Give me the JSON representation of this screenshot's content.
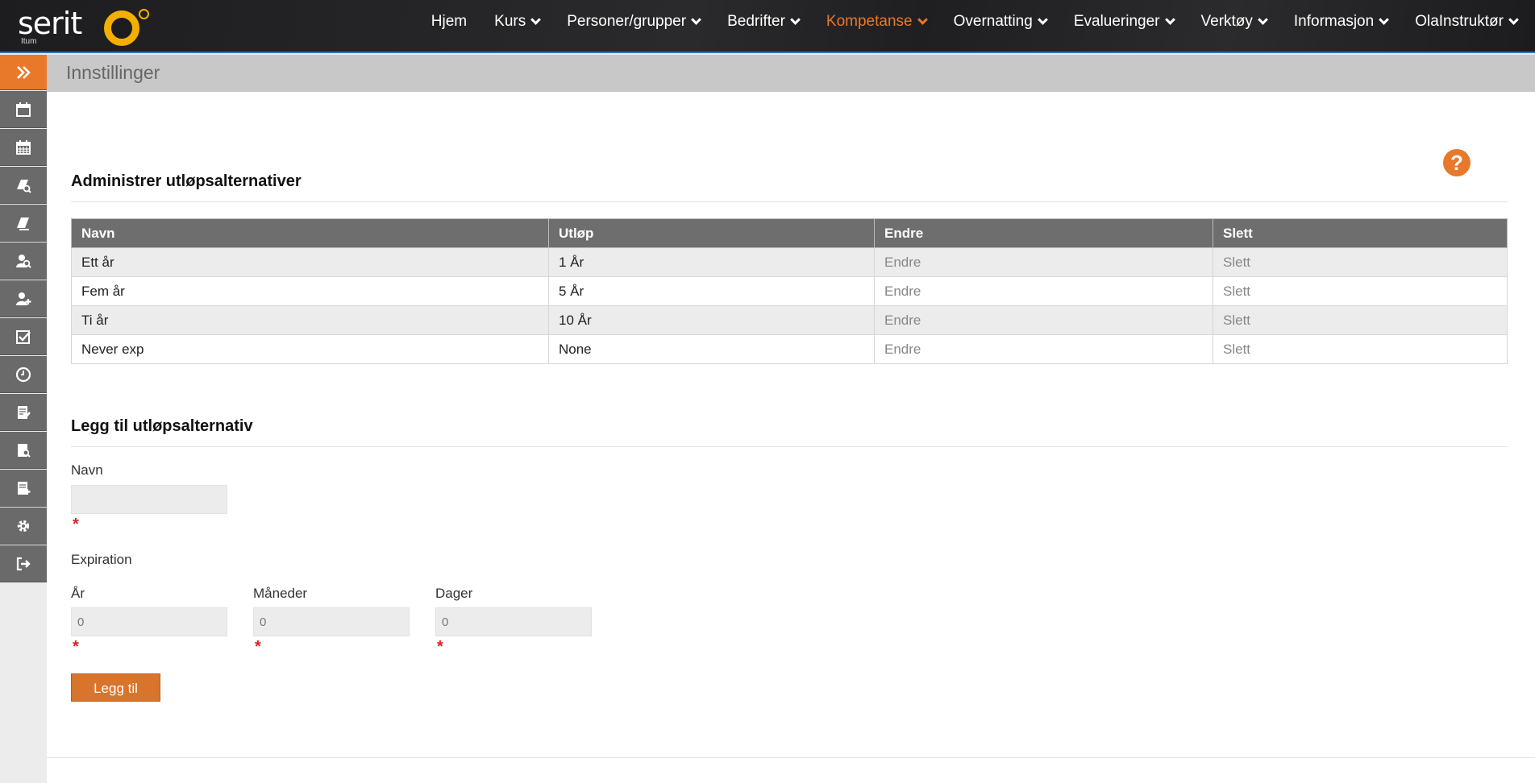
{
  "app": {
    "logo_text": "serit",
    "logo_sub": "Itum",
    "accent_color": "#e8782a"
  },
  "nav": {
    "items": [
      {
        "label": "Hjem",
        "dropdown": false
      },
      {
        "label": "Kurs",
        "dropdown": true
      },
      {
        "label": "Personer/grupper",
        "dropdown": true
      },
      {
        "label": "Bedrifter",
        "dropdown": true
      },
      {
        "label": "Kompetanse",
        "dropdown": true,
        "active": true
      },
      {
        "label": "Overnatting",
        "dropdown": true
      },
      {
        "label": "Evalueringer",
        "dropdown": true
      },
      {
        "label": "Verktøy",
        "dropdown": true
      },
      {
        "label": "Informasjon",
        "dropdown": true
      },
      {
        "label": "OlaInstruktør",
        "dropdown": true
      }
    ]
  },
  "sidebar": {
    "items": [
      "expand-icon",
      "calendar-icon",
      "calendar-grid-icon",
      "course-search-icon",
      "course-edit-icon",
      "person-search-icon",
      "add-person-icon",
      "checkbox-icon",
      "clock-icon",
      "document-edit-icon",
      "document-search-icon",
      "document-add-icon",
      "gear-icon",
      "logout-icon"
    ]
  },
  "page": {
    "title": "Innstillinger",
    "help_glyph": "?"
  },
  "list_section": {
    "heading": "Administrer utløpsalternativer",
    "columns": [
      "Navn",
      "Utløp",
      "Endre",
      "Slett"
    ],
    "rows": [
      {
        "name": "Ett år",
        "expiry": "1 År",
        "edit": "Endre",
        "delete": "Slett"
      },
      {
        "name": "Fem år",
        "expiry": "5 År",
        "edit": "Endre",
        "delete": "Slett"
      },
      {
        "name": "Ti år",
        "expiry": "10 År",
        "edit": "Endre",
        "delete": "Slett"
      },
      {
        "name": "Never exp",
        "expiry": "None",
        "edit": "Endre",
        "delete": "Slett"
      }
    ]
  },
  "add_section": {
    "heading": "Legg til utløpsalternativ",
    "name_label": "Navn",
    "name_value": "",
    "expiration_label": "Expiration",
    "years_label": "År",
    "years_value": "0",
    "months_label": "Måneder",
    "months_value": "0",
    "days_label": "Dager",
    "days_value": "0",
    "required_mark": "*",
    "submit_label": "Legg til"
  }
}
